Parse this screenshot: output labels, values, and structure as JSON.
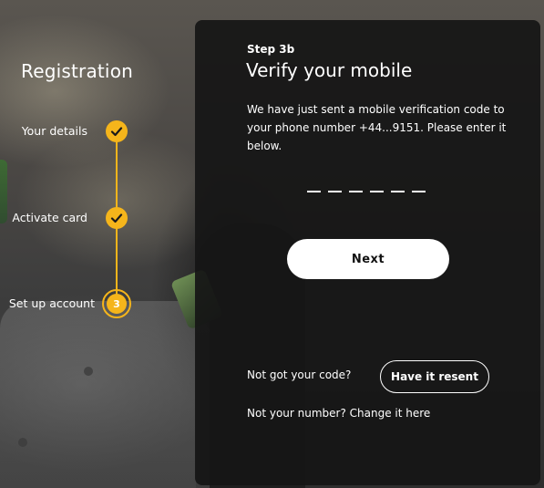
{
  "registration": {
    "title": "Registration",
    "steps": [
      {
        "label": "Your details",
        "state": "complete"
      },
      {
        "label": "Activate card",
        "state": "complete"
      },
      {
        "label": "Set up account",
        "state": "current",
        "number": "3"
      }
    ]
  },
  "panel": {
    "step_tag": "Step 3b",
    "title": "Verify your mobile",
    "description": "We have just sent a mobile verification code to your phone number +44...9151. Please enter it below.",
    "code_length": 6,
    "next_label": "Next",
    "not_got_code": "Not got your code?",
    "resend_label": "Have it resent",
    "change_number": "Not your number? Change it here"
  },
  "colors": {
    "accent": "#f5b51b",
    "panel_bg": "#161616",
    "button_bg": "#ffffff",
    "text": "#ffffff"
  }
}
